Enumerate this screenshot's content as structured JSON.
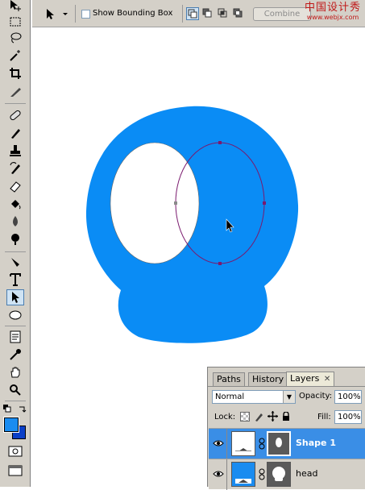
{
  "options_bar": {
    "show_bounding_box_label": "Show Bounding Box",
    "show_bounding_box_checked": false,
    "combine_label": "Combine"
  },
  "watermark": {
    "line1": "中国设计秀",
    "line2": "www.webjx.com"
  },
  "tools": [
    "move",
    "marquee",
    "lasso",
    "magic-wand",
    "crop",
    "slice",
    "healing-brush",
    "brush",
    "clone-stamp",
    "history-brush",
    "eraser",
    "paint-bucket",
    "blur",
    "dodge",
    "pen",
    "type",
    "path-selection",
    "ellipse",
    "notes",
    "eyedropper",
    "hand",
    "zoom"
  ],
  "active_tool": "path-selection",
  "colors": {
    "foreground": "#1a8cf0",
    "background": "#0b3fc7",
    "shape_fill": "#0a8cf5",
    "path_stroke": "#7a1a6e",
    "selection_blue": "#3a8ee6"
  },
  "layers_panel": {
    "tabs": [
      "Paths",
      "History",
      "Layers"
    ],
    "active_tab": "Layers",
    "blend_mode": "Normal",
    "opacity_label": "Opacity:",
    "opacity_value": "100%",
    "lock_label": "Lock:",
    "fill_label": "Fill:",
    "fill_value": "100%",
    "layers": [
      {
        "name": "Shape 1",
        "selected": true
      },
      {
        "name": "head",
        "selected": false
      }
    ]
  }
}
